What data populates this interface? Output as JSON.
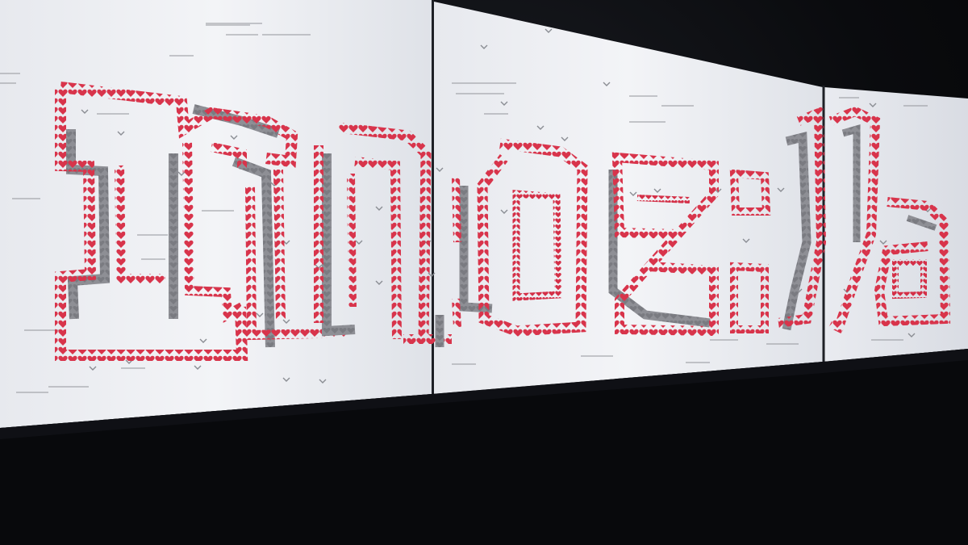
{
  "scene": {
    "description_free": true,
    "wordmark": "moz://a",
    "colors": {
      "screen": "#eef0f4",
      "screen_shadow": "#c9ccd3",
      "bezel": "#16181d",
      "heart": "#d8344b",
      "heart_dark": "#b7273c",
      "gray_block": "#8f9096",
      "gray_block_dark": "#6f7076",
      "chevron": "#8a8d93",
      "small_text": "#9a9ca3",
      "floor": "#07080b"
    },
    "icons": {
      "heart": "heart-icon",
      "chevron": "chevron-down-icon"
    }
  }
}
